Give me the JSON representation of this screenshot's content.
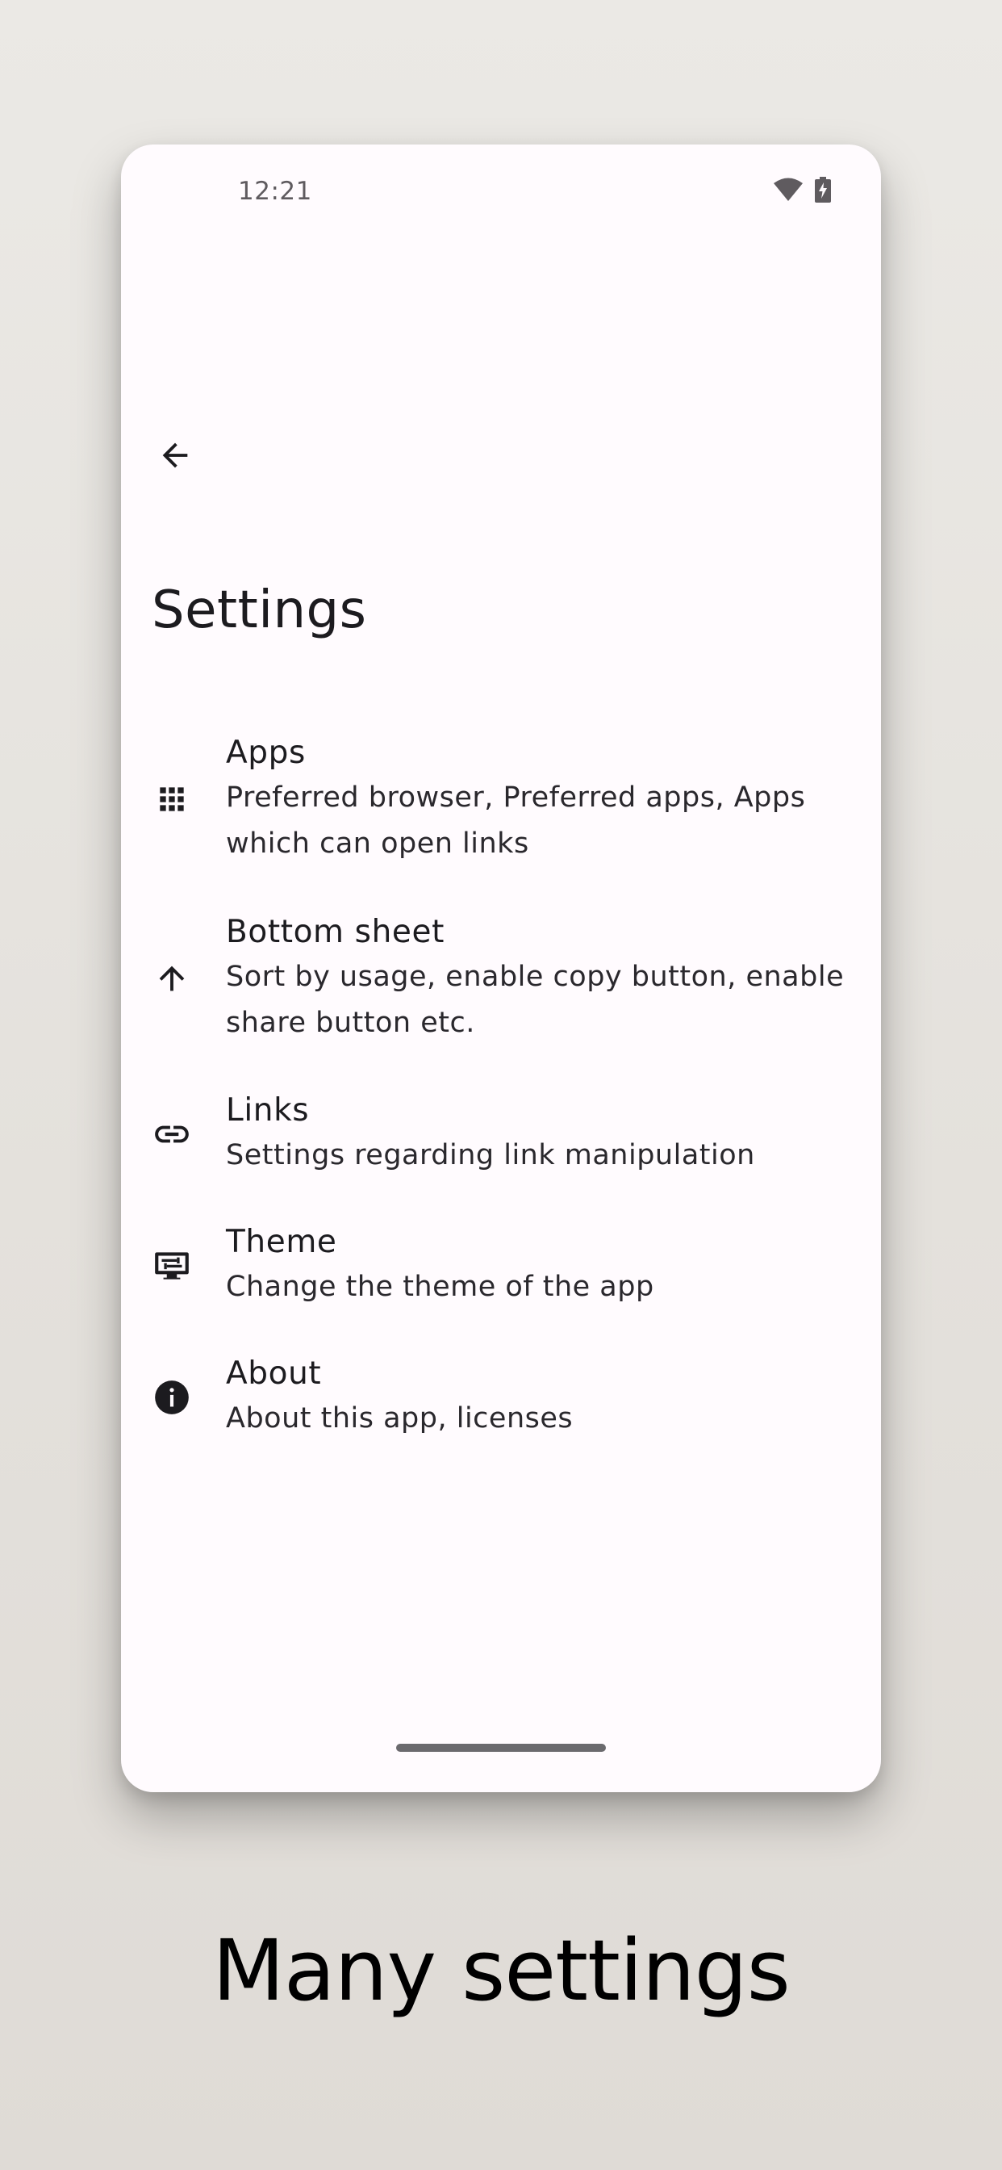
{
  "status_bar": {
    "time": "12:21",
    "icons": [
      "wifi-icon",
      "battery-charging-icon"
    ]
  },
  "header": {
    "back_icon": "arrow-back-icon",
    "title": "Settings"
  },
  "settings": [
    {
      "icon": "apps-grid-icon",
      "title": "Apps",
      "subtitle_lines": [
        "Preferred browser, Preferred apps, Apps",
        "which can open links"
      ]
    },
    {
      "icon": "arrow-up-icon",
      "title": "Bottom sheet",
      "subtitle_lines": [
        "Sort by usage, enable copy button, enable",
        "share button etc."
      ]
    },
    {
      "icon": "link-icon",
      "title": "Links",
      "subtitle_lines": [
        "Settings regarding link manipulation"
      ]
    },
    {
      "icon": "theme-display-icon",
      "title": "Theme",
      "subtitle_lines": [
        "Change the theme of the app"
      ]
    },
    {
      "icon": "info-icon",
      "title": "About",
      "subtitle_lines": [
        "About this app, licenses"
      ]
    }
  ],
  "caption": "Many settings",
  "colors": {
    "background": "#e6e3df",
    "surface": "#fffbfe",
    "text_primary": "#1c1b1f",
    "caption_text": "#000000"
  }
}
